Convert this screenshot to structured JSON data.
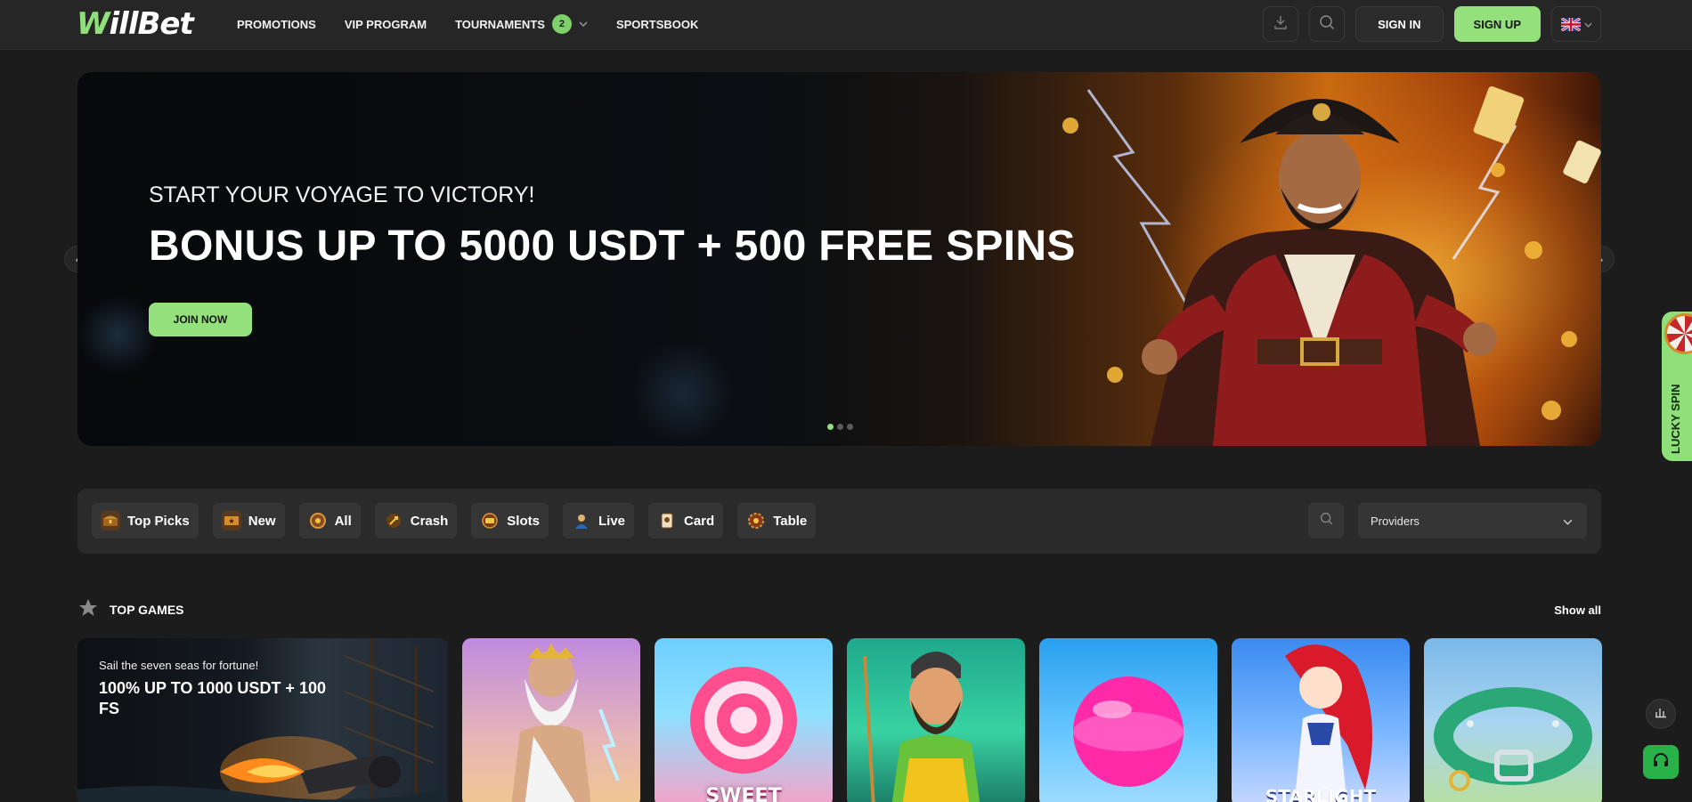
{
  "header": {
    "logo": {
      "first": "W",
      "rest": "illBet"
    },
    "nav": [
      {
        "label": "PROMOTIONS"
      },
      {
        "label": "VIP PROGRAM"
      },
      {
        "label": "TOURNAMENTS",
        "badge": "2"
      },
      {
        "label": "SPORTSBOOK"
      }
    ],
    "sign_in": "SIGN IN",
    "sign_up": "SIGN UP",
    "language_flag": "uk-flag-icon"
  },
  "hero": {
    "subtitle": "START YOUR VOYAGE TO VICTORY!",
    "title": "BONUS UP TO 5000 USDT + 500 FREE SPINS",
    "cta": "JOIN NOW",
    "slides_total": 3,
    "active_slide": 1
  },
  "filters": {
    "categories": [
      {
        "label": "Top Picks",
        "icon": "treasure-chest-icon"
      },
      {
        "label": "New",
        "icon": "ticket-icon"
      },
      {
        "label": "All",
        "icon": "wheel-icon"
      },
      {
        "label": "Crash",
        "icon": "rocket-icon"
      },
      {
        "label": "Slots",
        "icon": "slot-icon"
      },
      {
        "label": "Live",
        "icon": "dealer-icon"
      },
      {
        "label": "Card",
        "icon": "card-icon"
      },
      {
        "label": "Table",
        "icon": "roulette-icon"
      }
    ],
    "providers_label": "Providers"
  },
  "top_games": {
    "title": "TOP GAMES",
    "show_all": "Show all",
    "promo": {
      "subtitle": "Sail the seven seas for fortune!",
      "title": "100% UP TO 1000 USDT + 100 FS"
    },
    "games": [
      {
        "name": "zeus-game",
        "label": ""
      },
      {
        "name": "sweet-bonanza-game",
        "label": "SWEET"
      },
      {
        "name": "big-bass-game",
        "label": ""
      },
      {
        "name": "candy-game",
        "label": ""
      },
      {
        "name": "starlight-princess-game",
        "label": "STARLIGHT"
      },
      {
        "name": "dog-collar-game",
        "label": ""
      }
    ]
  },
  "widgets": {
    "lucky_spin": "LUCKY SPIN"
  },
  "colors": {
    "accent_green": "#93e07d",
    "background": "#1c1c1c",
    "header": "#262626",
    "support_green": "#2ab24a"
  }
}
